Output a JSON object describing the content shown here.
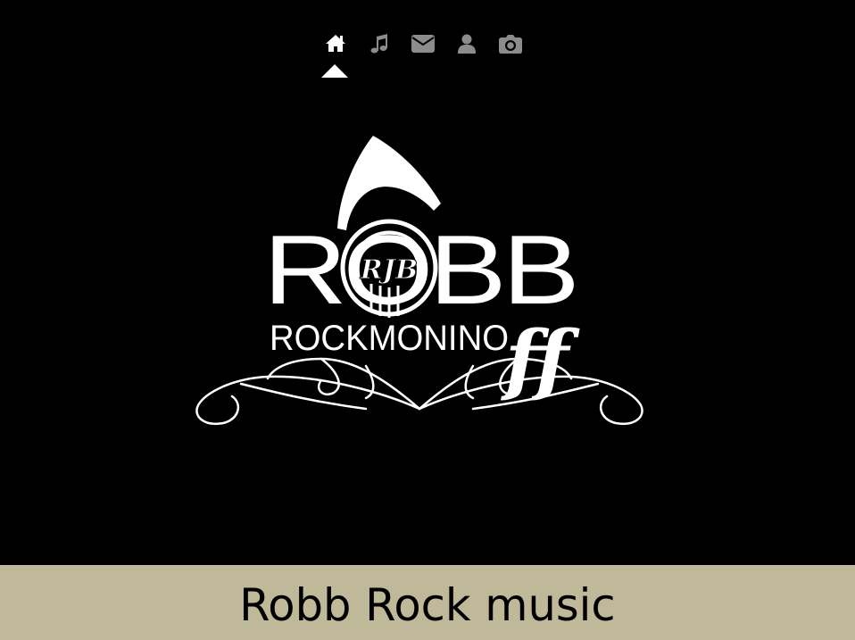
{
  "colors": {
    "background": "#000000",
    "footer_bg": "#bfb899",
    "nav_active": "#ffffff",
    "nav_inactive": "#8c8c8c"
  },
  "nav": {
    "items": [
      {
        "icon": "home-icon",
        "active": true
      },
      {
        "icon": "music-note-icon",
        "active": false
      },
      {
        "icon": "envelope-icon",
        "active": false
      },
      {
        "icon": "user-icon",
        "active": false
      },
      {
        "icon": "camera-icon",
        "active": false
      }
    ]
  },
  "logo": {
    "line1": "ROBB",
    "line2": "ROCKMONINO",
    "suffix": "ff",
    "monogram": "RJB"
  },
  "footer": {
    "title": "Robb Rock music"
  }
}
